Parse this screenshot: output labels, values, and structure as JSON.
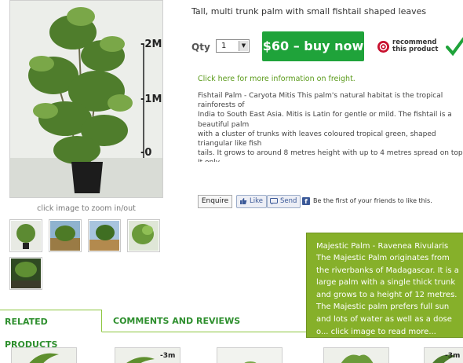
{
  "product": {
    "short_description": "Tall, multi trunk palm with small fishtail shaped leaves",
    "image_markers": [
      "-2M",
      "-1M",
      "-0"
    ],
    "zoom_caption": "click image to zoom in/out",
    "qty_label": "Qty",
    "qty_value": "1",
    "buy_button": "$60 – buy now",
    "recommend_line1": "recommend",
    "recommend_line2": "this product",
    "freight_link": "Click here for more information on freight.",
    "long_description": "Fishtail Palm - Caryota Mitis This palm's natural habitat is the tropical rainforests of\nIndia to South East Asia. Mitis is Latin for gentle or mild. The fishtail is a beautiful palm\nwith a cluster of trunks with leaves coloured tropical green, shaped triangular like fish\ntails. It grows to around 8 metres height with up to 4 metres spread on top. It only\nproduces flowers; starting from the top of the trunk and after the last seed stalk that\nparticular trunk dies, leaving all the other trunks still maintaining the integrity of the\nplant."
  },
  "social": {
    "enquire": "Enquire",
    "like": "Like",
    "send": "Send",
    "fb_text": "Be the first of your friends to like this."
  },
  "tabs": {
    "related": "RELATED PRODUCTS",
    "comments": "COMMENTS AND REVIEWS"
  },
  "tooltip": {
    "title": "Majestic Palm - Ravenea Rivularis",
    "body": "The Majestic Palm originates from the riverbanks of Madagascar. It is a large palm with a single thick trunk and grows to a height of 12 metres. The Majestic palm prefers full sun and lots of water as well as a dose o... click image to read more..."
  },
  "colors": {
    "buy_green": "#1fa33a",
    "tab_green": "#2e8f2e",
    "tooltip_green": "#86b02a",
    "link_green": "#5a9a1a"
  }
}
